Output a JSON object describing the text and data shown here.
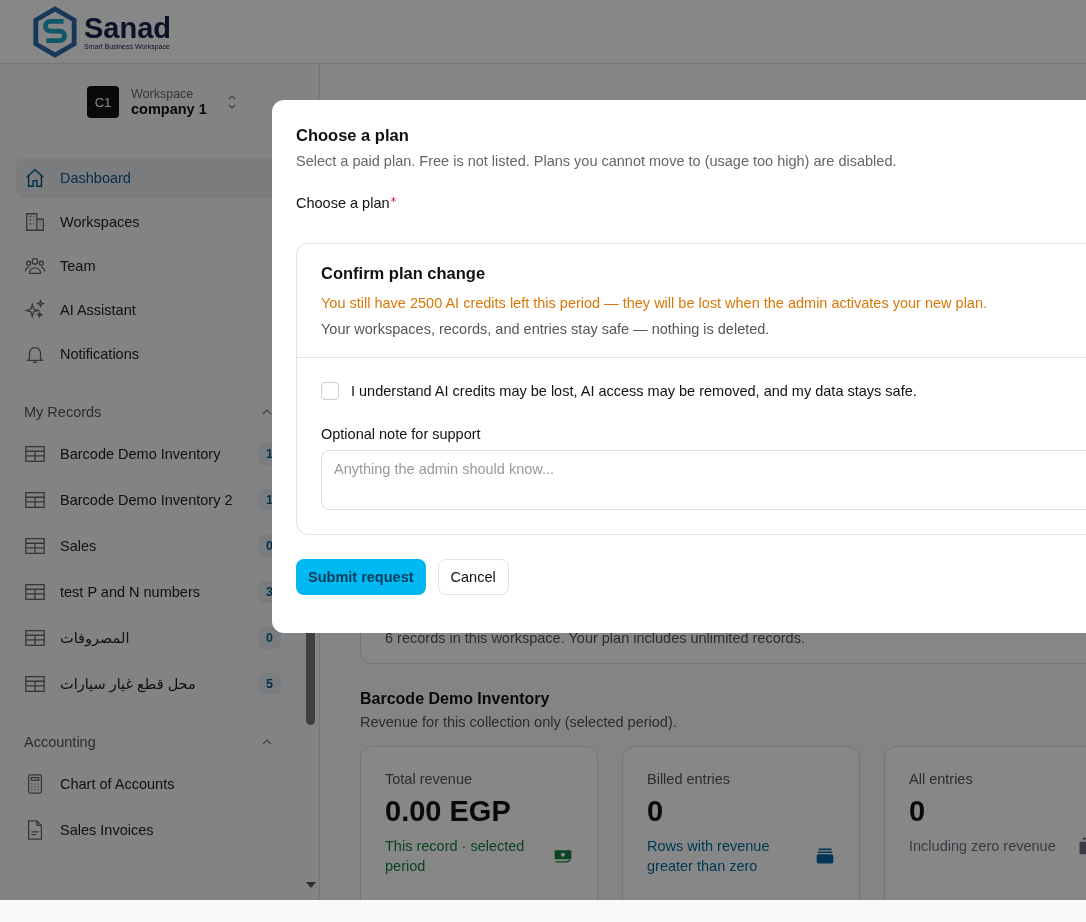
{
  "brand": {
    "name": "Sanad",
    "tagline": "Smart Business Workspace"
  },
  "workspace": {
    "initials": "C1",
    "label": "Workspace",
    "name": "company 1"
  },
  "nav": [
    {
      "label": "Dashboard",
      "kind": "home",
      "selected": true
    },
    {
      "label": "Workspaces",
      "kind": "building",
      "selected": false
    },
    {
      "label": "Team",
      "kind": "people",
      "selected": false
    },
    {
      "label": "AI Assistant",
      "kind": "sparkles",
      "selected": false
    },
    {
      "label": "Notifications",
      "kind": "bell",
      "selected": false
    }
  ],
  "sections": [
    {
      "title": "My Records",
      "expanded": true,
      "items": [
        {
          "label": "Barcode Demo Inventory",
          "kind": "table",
          "count": "1"
        },
        {
          "label": "Barcode Demo Inventory 2",
          "kind": "table",
          "count": "1"
        },
        {
          "label": "Sales",
          "kind": "table",
          "count": "0"
        },
        {
          "label": "test P and N numbers",
          "kind": "table",
          "count": "3"
        },
        {
          "label": "المصروفات",
          "kind": "table",
          "count": "0"
        },
        {
          "label": "محل قطع غيار سيارات",
          "kind": "table",
          "count": "5"
        }
      ]
    },
    {
      "title": "Accounting",
      "expanded": true,
      "items": [
        {
          "label": "Chart of Accounts",
          "kind": "calculator"
        },
        {
          "label": "Sales Invoices",
          "kind": "document"
        }
      ]
    }
  ],
  "main": {
    "records_note": "6 records in this workspace. Your plan includes unlimited records.",
    "collection": {
      "title": "Barcode Demo Inventory",
      "subtitle": "Revenue for this collection only (selected period)."
    },
    "stats": [
      {
        "label": "Total revenue",
        "value": "0.00 EGP",
        "note": "This record · selected period",
        "kind": "cash"
      },
      {
        "label": "Billed entries",
        "value": "0",
        "note": "Rows with revenue greater than zero",
        "kind": "stack"
      },
      {
        "label": "All entries",
        "value": "0",
        "note": "Including zero revenue",
        "kind": "copy"
      }
    ]
  },
  "modal": {
    "title": "Choose a plan",
    "description": "Select a paid plan. Free is not listed. Plans you cannot move to (usage too high) are disabled.",
    "field_label": "Choose a plan",
    "required": true,
    "confirm": {
      "title": "Confirm plan change",
      "warning": "You still have 2500 AI credits left this period — they will be lost when the admin activates your new plan.",
      "info": "Your workspaces, records, and entries stay safe — nothing is deleted.",
      "checkbox": {
        "label": "I understand AI credits may be lost, AI access may be removed, and my data stays safe.",
        "checked": false
      },
      "note": {
        "label": "Optional note for support",
        "placeholder": "Anything the admin should know..."
      }
    },
    "buttons": [
      {
        "label": "Submit request",
        "kind": "primary"
      },
      {
        "label": "Cancel",
        "kind": "secondary"
      }
    ]
  }
}
